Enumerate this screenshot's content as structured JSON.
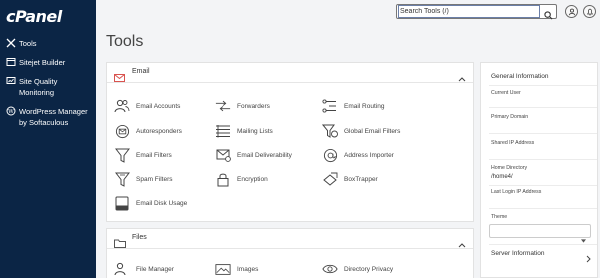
{
  "brand": {
    "logo_text": "cPanel"
  },
  "sidebar": {
    "items": [
      {
        "label": "Tools",
        "icon": "tools-icon"
      },
      {
        "label": "Sitejet Builder",
        "icon": "sitejet-icon"
      },
      {
        "label": "Site Quality Monitoring",
        "icon": "site-quality-icon"
      },
      {
        "label": "WordPress Manager by Softaculous",
        "icon": "wordpress-icon"
      }
    ]
  },
  "topbar": {
    "search_placeholder": "Search Tools (/)",
    "search_value": "Search Tools (/)",
    "user_button_icon": "user-icon",
    "notifications_button_icon": "bell-icon"
  },
  "page": {
    "title": "Tools"
  },
  "email_panel": {
    "title": "Email",
    "tools": [
      {
        "label": "Email Accounts",
        "icon": "users-icon"
      },
      {
        "label": "Forwarders",
        "icon": "forwarders-icon"
      },
      {
        "label": "Email Routing",
        "icon": "routing-icon"
      },
      {
        "label": "Autoresponders",
        "icon": "autoresponder-icon"
      },
      {
        "label": "Mailing Lists",
        "icon": "list-icon"
      },
      {
        "label": "Global Email Filters",
        "icon": "global-filter-icon"
      },
      {
        "label": "Email Filters",
        "icon": "filter-icon"
      },
      {
        "label": "Email Deliverability",
        "icon": "deliverability-icon"
      },
      {
        "label": "Address Importer",
        "icon": "at-icon"
      },
      {
        "label": "Spam Filters",
        "icon": "spam-filter-icon"
      },
      {
        "label": "Encryption",
        "icon": "lock-icon"
      },
      {
        "label": "BoxTrapper",
        "icon": "boxtrapper-icon"
      },
      {
        "label": "Email Disk Usage",
        "icon": "disk-icon"
      }
    ]
  },
  "files_panel": {
    "title": "Files",
    "tools": [
      {
        "label": "File Manager",
        "icon": "file-manager-icon"
      },
      {
        "label": "Images",
        "icon": "images-icon"
      },
      {
        "label": "Directory Privacy",
        "icon": "eye-icon"
      }
    ]
  },
  "general_info": {
    "title": "General Information",
    "current_user_label": "Current User",
    "primary_domain_label": "Primary Domain",
    "shared_ip_label": "Shared IP Address",
    "home_directory_label": "Home Directory",
    "home_directory_value": "/home4/",
    "last_login_label": "Last Login IP Address",
    "theme_label": "Theme",
    "server_info_label": "Server Information"
  },
  "colors": {
    "sidebar_bg": "#0b2545",
    "email_accent": "#d9534f"
  }
}
